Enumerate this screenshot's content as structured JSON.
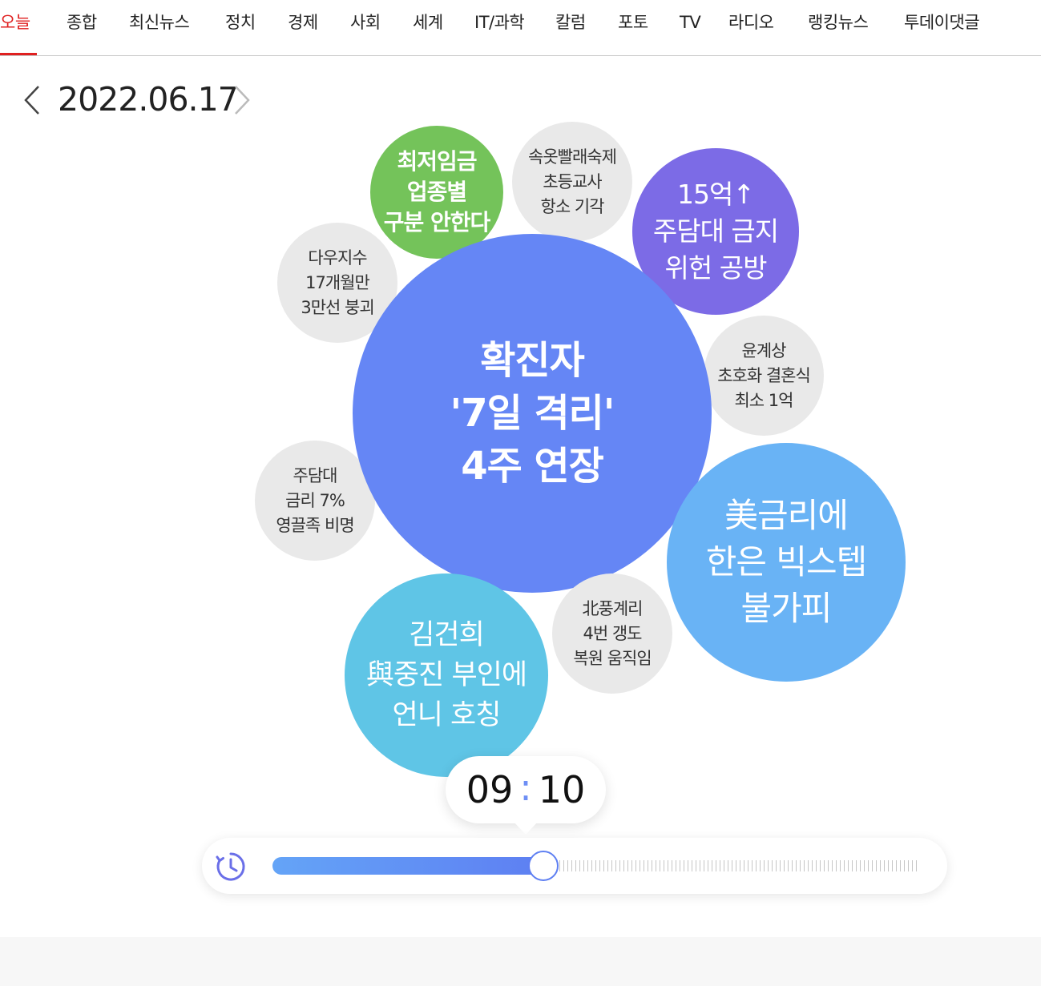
{
  "nav": {
    "items": [
      {
        "label": "오늘",
        "active": true
      },
      {
        "label": "종합"
      },
      {
        "label": "최신뉴스"
      },
      {
        "label": "정치"
      },
      {
        "label": "경제"
      },
      {
        "label": "사회"
      },
      {
        "label": "세계"
      },
      {
        "label": "IT/과학"
      },
      {
        "label": "칼럼"
      },
      {
        "label": "포토"
      },
      {
        "label": "TV"
      },
      {
        "label": "라디오"
      },
      {
        "label": "랭킹뉴스"
      },
      {
        "label": "투데이댓글"
      }
    ],
    "active_color": "#e02020"
  },
  "date": {
    "value": "2022.06.17",
    "prev_icon": "chevron-left-icon",
    "next_icon": "chevron-right-icon"
  },
  "bubbles": [
    {
      "id": "minwage",
      "text": "최저임금\n업종별\n구분 안한다",
      "color": "#74c35a"
    },
    {
      "id": "underwear",
      "text": "속옷빨래숙제\n초등교사\n항소 기각",
      "color": "#e9e9e9"
    },
    {
      "id": "mortgage-ban",
      "text": "15억↑\n주담대 금지\n위헌 공방",
      "color": "#7c6be6"
    },
    {
      "id": "dow",
      "text": "다우지수\n17개월만\n3만선 붕괴",
      "color": "#e9e9e9"
    },
    {
      "id": "quarantine",
      "text": "확진자\n'7일 격리'\n4주 연장",
      "color": "#6586f5"
    },
    {
      "id": "wedding",
      "text": "윤계상\n초호화 결혼식\n최소 1억",
      "color": "#e9e9e9"
    },
    {
      "id": "mortgage-rate",
      "text": "주담대\n금리 7%\n영끌족 비명",
      "color": "#e9e9e9"
    },
    {
      "id": "bigstep",
      "text": "美금리에\n한은 빅스텝\n불가피",
      "color": "#69b3f5"
    },
    {
      "id": "nk-punggye",
      "text": "北풍계리\n4번 갱도\n복원 움직임",
      "color": "#e9e9e9"
    },
    {
      "id": "kimkeonhee",
      "text": "김건희\n與중진 부인에\n언니 호칭",
      "color": "#5fc5e6"
    }
  ],
  "time": {
    "hour": "09",
    "colon": ":",
    "minute": "10",
    "progress": 0.42
  },
  "slider": {
    "icon": "clock-icon",
    "fill_from": "#64a4f7",
    "fill_to": "#5e7ff2"
  }
}
